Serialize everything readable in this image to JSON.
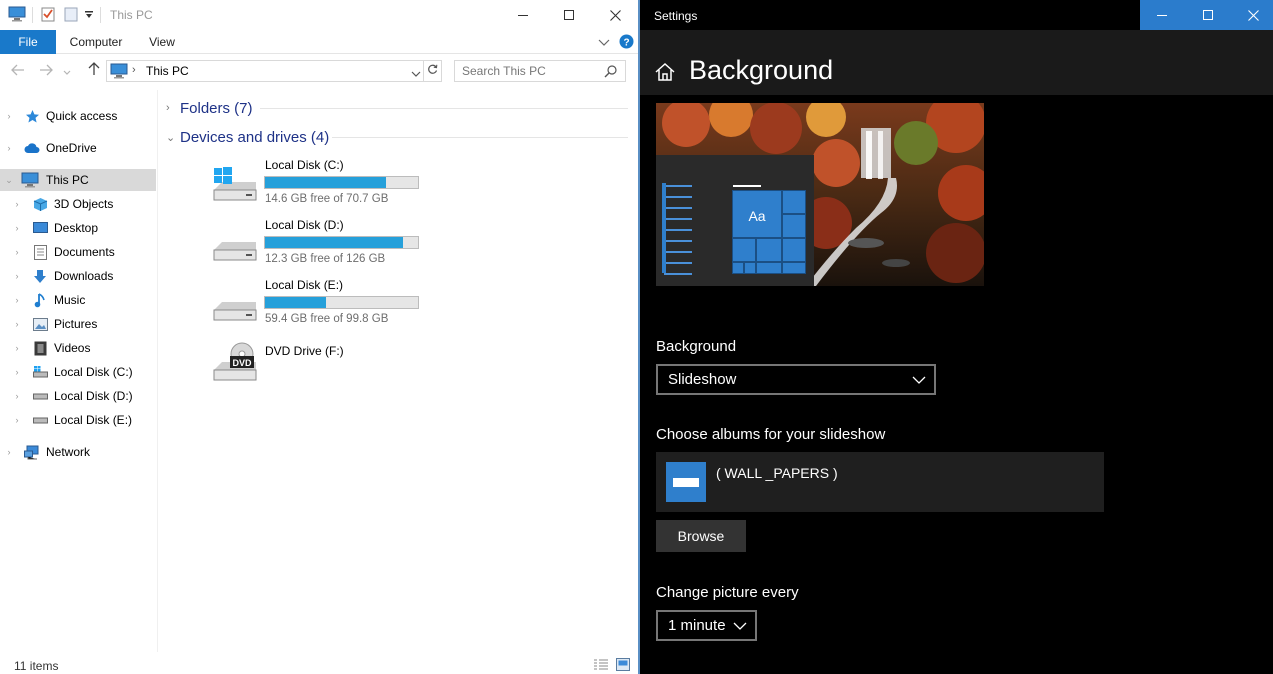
{
  "explorer": {
    "title": "This PC",
    "ribbon_tabs": [
      "File",
      "Computer",
      "View"
    ],
    "address": "This PC",
    "search_placeholder": "Search This PC",
    "nav": [
      {
        "label": "Quick access",
        "icon": "star-icon"
      },
      {
        "label": "OneDrive",
        "icon": "cloud-icon"
      },
      {
        "label": "This PC",
        "icon": "computer-icon"
      },
      {
        "label": "3D Objects",
        "icon": "cube-icon"
      },
      {
        "label": "Desktop",
        "icon": "desktop-icon"
      },
      {
        "label": "Documents",
        "icon": "document-icon"
      },
      {
        "label": "Downloads",
        "icon": "download-icon"
      },
      {
        "label": "Music",
        "icon": "music-icon"
      },
      {
        "label": "Pictures",
        "icon": "picture-icon"
      },
      {
        "label": "Videos",
        "icon": "film-icon"
      },
      {
        "label": "Local Disk (C:)",
        "icon": "drive-icon"
      },
      {
        "label": "Local Disk (D:)",
        "icon": "drive-icon"
      },
      {
        "label": "Local Disk (E:)",
        "icon": "drive-icon"
      },
      {
        "label": "Network",
        "icon": "network-icon"
      }
    ],
    "groups": {
      "folders": "Folders (7)",
      "devices": "Devices and drives (4)"
    },
    "drives": [
      {
        "name": "Local Disk (C:)",
        "free": "14.6 GB free of 70.7 GB",
        "used_fraction": 0.79
      },
      {
        "name": "Local Disk (D:)",
        "free": "12.3 GB free of 126 GB",
        "used_fraction": 0.9
      },
      {
        "name": "Local Disk (E:)",
        "free": "59.4 GB free of 99.8 GB",
        "used_fraction": 0.4
      },
      {
        "name": "DVD Drive (F:)"
      }
    ],
    "status": "11 items",
    "accent": "#1979ca",
    "bar_fill": "#26a0da"
  },
  "settings": {
    "window_title": "Settings",
    "heading": "Background",
    "preview_text": "Aa",
    "background_label": "Background",
    "background_value": "Slideshow",
    "albums_label": "Choose albums for your slideshow",
    "album_name": "( WALL _PAPERS )",
    "browse_label": "Browse",
    "interval_label": "Change picture every",
    "interval_value": "1 minute",
    "accent": "#2b7ccc"
  }
}
